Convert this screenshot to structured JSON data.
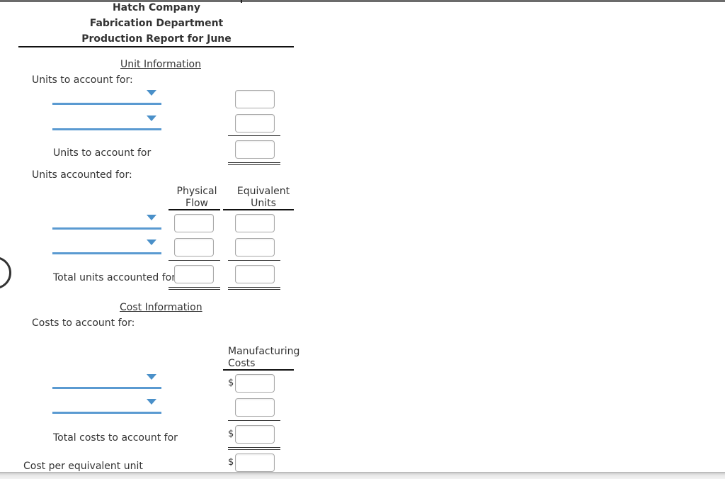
{
  "header": {
    "company": "Hatch Company",
    "department": "Fabrication Department",
    "report_title": "Production Report for June"
  },
  "unit_information": {
    "section_title": "Unit Information",
    "units_to_account_for": {
      "label": "Units to account for:",
      "dropdowns": [
        {
          "selected": "",
          "input_value": ""
        },
        {
          "selected": "",
          "input_value": ""
        }
      ],
      "total_label": "Units to account for",
      "total_value": ""
    },
    "units_accounted_for": {
      "label": "Units accounted for:",
      "columns": [
        "Physical Flow",
        "Equivalent Units"
      ],
      "column_lines": [
        [
          "Physical",
          "Flow"
        ],
        [
          "Equivalent",
          "Units"
        ]
      ],
      "rows": [
        {
          "selected": "",
          "physical_flow": "",
          "equivalent_units": ""
        },
        {
          "selected": "",
          "physical_flow": "",
          "equivalent_units": ""
        }
      ],
      "total_label": "Total units accounted for",
      "total_physical_flow": "",
      "total_equivalent_units": ""
    }
  },
  "cost_information": {
    "section_title": "Cost Information",
    "costs_to_account_for": {
      "label": "Costs to account for:",
      "column_lines": [
        "Manufacturing",
        "Costs"
      ],
      "rows": [
        {
          "selected": "",
          "currency": "$",
          "value": ""
        },
        {
          "selected": "",
          "currency": "",
          "value": ""
        }
      ],
      "total_label": "Total costs to account for",
      "total_currency": "$",
      "total_value": ""
    },
    "cost_per_equivalent_unit": {
      "label": "Cost per equivalent unit",
      "currency": "$",
      "value": ""
    }
  },
  "colors": {
    "dropdown_accent": "#5a9ad1",
    "text": "#333333"
  }
}
